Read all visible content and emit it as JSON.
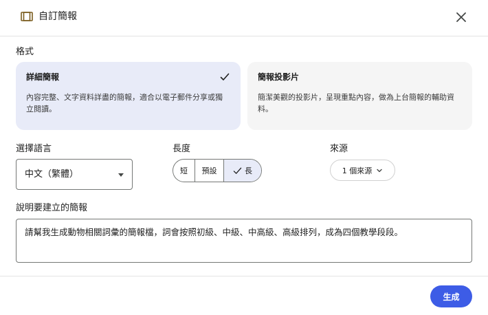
{
  "dialog": {
    "title": "自訂簡報",
    "icon": "slides-icon",
    "close_icon": "close-icon"
  },
  "format": {
    "label": "格式",
    "options": [
      {
        "title": "詳細簡報",
        "desc_line1": "內容完整、文字資料詳盡的簡報，適合以電子郵件分享或獨",
        "desc_line2": "立閱讀。",
        "selected": true
      },
      {
        "title": "簡報投影片",
        "desc_line1": "簡潔美觀的投影片，呈現重點內容，做為上台簡報的輔助資",
        "desc_line2": "料。",
        "selected": false
      }
    ]
  },
  "language": {
    "label": "選擇語言",
    "value": "中文（繁體）"
  },
  "length": {
    "label": "長度",
    "options": [
      "短",
      "預設",
      "長"
    ],
    "selected": "長"
  },
  "source": {
    "label": "來源",
    "button_label": "1 個來源"
  },
  "prompt": {
    "label": "說明要建立的簡報",
    "value": "請幫我生成動物相關詞彙的簡報檔，詞會按照初級、中級、中高級、高級排列，成為四個教學段段。"
  },
  "footer": {
    "generate_label": "生成"
  },
  "colors": {
    "accent": "#3d5ce6",
    "selected_bg": "#e8ebf8",
    "card_bg": "#f5f5f5",
    "icon_gold": "#7a5c1e"
  }
}
